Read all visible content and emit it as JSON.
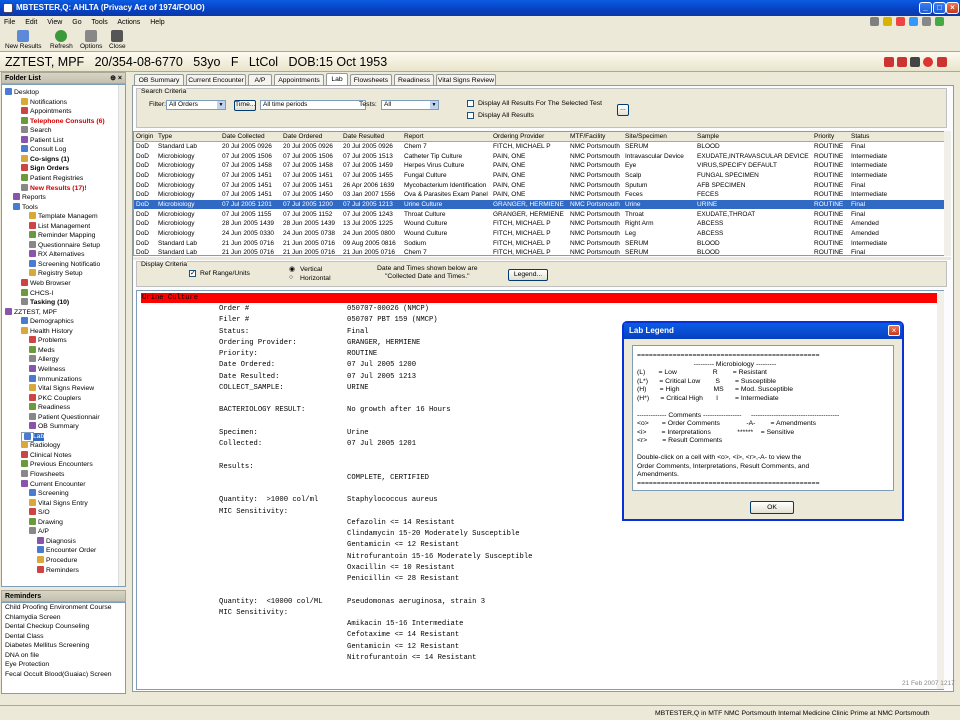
{
  "app_title": "MBTESTER,Q: AHLTA (Privacy Act of 1974/FOUO)",
  "menu": [
    "File",
    "Edit",
    "View",
    "Go",
    "Tools",
    "Actions",
    "Help"
  ],
  "toolbar": {
    "new_results": "New Results",
    "refresh": "Refresh",
    "options": "Options",
    "close": "Close"
  },
  "patient": {
    "name": "ZZTEST, MPF",
    "id": "20/354-08-6770",
    "age": "53yo",
    "sex": "F",
    "rank": "LtCol",
    "dob": "DOB:15 Oct 1953"
  },
  "folder_list": {
    "title": "Folder List",
    "items": [
      {
        "label": "Desktop",
        "indent": 0,
        "style": ""
      },
      {
        "label": "Notifications",
        "indent": 2,
        "style": ""
      },
      {
        "label": "Appointments",
        "indent": 2,
        "style": ""
      },
      {
        "label": "Telephone Consults (6)",
        "indent": 2,
        "style": "red"
      },
      {
        "label": "Search",
        "indent": 2,
        "style": ""
      },
      {
        "label": "Patient List",
        "indent": 2,
        "style": ""
      },
      {
        "label": "Consult Log",
        "indent": 2,
        "style": ""
      },
      {
        "label": "Co-signs (1)",
        "indent": 2,
        "style": "bold"
      },
      {
        "label": "Sign Orders",
        "indent": 2,
        "style": "bold"
      },
      {
        "label": "Patient Registries",
        "indent": 2,
        "style": ""
      },
      {
        "label": "New Results (17)!",
        "indent": 2,
        "style": "red"
      },
      {
        "label": "Reports",
        "indent": 1,
        "style": ""
      },
      {
        "label": "Tools",
        "indent": 1,
        "style": ""
      },
      {
        "label": "Template Managem",
        "indent": 3,
        "style": ""
      },
      {
        "label": "List Management",
        "indent": 3,
        "style": ""
      },
      {
        "label": "Reminder Mapping",
        "indent": 3,
        "style": ""
      },
      {
        "label": "Questionnaire Setup",
        "indent": 3,
        "style": ""
      },
      {
        "label": "RX Alternatives",
        "indent": 3,
        "style": ""
      },
      {
        "label": "Screening Notificatio",
        "indent": 3,
        "style": ""
      },
      {
        "label": "Registry Setup",
        "indent": 3,
        "style": ""
      },
      {
        "label": "Web Browser",
        "indent": 2,
        "style": ""
      },
      {
        "label": "CHCS-I",
        "indent": 2,
        "style": ""
      },
      {
        "label": "Tasking (10)",
        "indent": 2,
        "style": "bold"
      },
      {
        "label": "ZZTEST, MPF",
        "indent": 0,
        "style": ""
      },
      {
        "label": "Demographics",
        "indent": 2,
        "style": ""
      },
      {
        "label": "Health History",
        "indent": 2,
        "style": ""
      },
      {
        "label": "Problems",
        "indent": 3,
        "style": ""
      },
      {
        "label": "Meds",
        "indent": 3,
        "style": ""
      },
      {
        "label": "Allergy",
        "indent": 3,
        "style": ""
      },
      {
        "label": "Wellness",
        "indent": 3,
        "style": ""
      },
      {
        "label": "Immunizations",
        "indent": 3,
        "style": ""
      },
      {
        "label": "Vital Signs Review",
        "indent": 3,
        "style": ""
      },
      {
        "label": "PKC Couplers",
        "indent": 3,
        "style": ""
      },
      {
        "label": "Readiness",
        "indent": 3,
        "style": ""
      },
      {
        "label": "Patient Questionnair",
        "indent": 3,
        "style": ""
      },
      {
        "label": "OB Summary",
        "indent": 3,
        "style": ""
      },
      {
        "label": "Lab",
        "indent": 2,
        "style": "sel"
      },
      {
        "label": "Radiology",
        "indent": 2,
        "style": ""
      },
      {
        "label": "Clinical Notes",
        "indent": 2,
        "style": ""
      },
      {
        "label": "Previous Encounters",
        "indent": 2,
        "style": ""
      },
      {
        "label": "Flowsheets",
        "indent": 2,
        "style": ""
      },
      {
        "label": "Current Encounter",
        "indent": 2,
        "style": ""
      },
      {
        "label": "Screening",
        "indent": 3,
        "style": ""
      },
      {
        "label": "Vital Signs Entry",
        "indent": 3,
        "style": ""
      },
      {
        "label": "S/O",
        "indent": 3,
        "style": ""
      },
      {
        "label": "Drawing",
        "indent": 3,
        "style": ""
      },
      {
        "label": "A/P",
        "indent": 3,
        "style": ""
      },
      {
        "label": "Diagnosis",
        "indent": 4,
        "style": ""
      },
      {
        "label": "Encounter Order",
        "indent": 4,
        "style": ""
      },
      {
        "label": "Procedure",
        "indent": 4,
        "style": ""
      },
      {
        "label": "Reminders",
        "indent": 4,
        "style": ""
      }
    ]
  },
  "reminders": {
    "title": "Reminders",
    "items": [
      "Child Proofing Environment Course",
      "Chlamydia Screen",
      "Dental Checkup Counseling",
      "Dental Class",
      "Diabetes Mellitus Screening",
      "DNA on file",
      "Eye Protection",
      "Fecal Occult Blood(Guaiac) Screen"
    ]
  },
  "tabs": [
    "OB Summary",
    "Current Encounter",
    "A/P",
    "Appointments",
    "Lab",
    "Flowsheets",
    "Readiness",
    "Vital Signs Review"
  ],
  "active_tab": "Lab",
  "search": {
    "legend": "Search Criteria",
    "filter_label": "Filter:",
    "filter_value": "All Orders",
    "time_button": "Time...",
    "time_value": "All time periods",
    "tests_label": "Tests:",
    "tests_value": "All",
    "display_selected": "Display All Results For The Selected Test",
    "display_all": "Display All Results",
    "more_button": "..."
  },
  "grid": {
    "columns": [
      "Origin",
      "Type",
      "Date Collected",
      "Date Ordered",
      "Date Resulted",
      "Report",
      "Ordering Provider",
      "MTF/Facility",
      "Site/Specimen",
      "Sample",
      "Priority",
      "Status"
    ],
    "rows": [
      [
        "DoD",
        "Standard Lab",
        "20 Jul 2005 0926",
        "20 Jul 2005 0926",
        "20 Jul 2005 0926",
        "Chem 7",
        "FITCH, MICHAEL P",
        "NMC Portsmouth",
        "SERUM",
        "BLOOD",
        "ROUTINE",
        "Final"
      ],
      [
        "DoD",
        "Microbiology",
        "07 Jul 2005 1506",
        "07 Jul 2005 1506",
        "07 Jul 2005 1513",
        "Catheter Tip Culture",
        "PAIN, ONE",
        "NMC Portsmouth",
        "Intravascular Device",
        "EXUDATE,INTRAVASCULAR DEVICE",
        "ROUTINE",
        "Intermediate"
      ],
      [
        "DoD",
        "Microbiology",
        "07 Jul 2005 1458",
        "07 Jul 2005 1458",
        "07 Jul 2005 1459",
        "Herpes Virus Culture",
        "PAIN, ONE",
        "NMC Portsmouth",
        "Eye",
        "VIRUS,SPECIFY DEFAULT",
        "ROUTINE",
        "Intermediate"
      ],
      [
        "DoD",
        "Microbiology",
        "07 Jul 2005 1451",
        "07 Jul 2005 1451",
        "07 Jul 2005 1455",
        "Fungal Culture",
        "PAIN, ONE",
        "NMC Portsmouth",
        "Scalp",
        "FUNGAL SPECIMEN",
        "ROUTINE",
        "Intermediate"
      ],
      [
        "DoD",
        "Microbiology",
        "07 Jul 2005 1451",
        "07 Jul 2005 1451",
        "26 Apr 2006 1639",
        "Mycobacterium Identification",
        "PAIN, ONE",
        "NMC Portsmouth",
        "Sputum",
        "AFB SPECIMEN",
        "ROUTINE",
        "Final"
      ],
      [
        "DoD",
        "Microbiology",
        "07 Jul 2005 1451",
        "07 Jul 2005 1450",
        "03 Jan 2007 1556",
        "Ova & Parasites Exam Panel",
        "PAIN, ONE",
        "NMC Portsmouth",
        "Feces",
        "FECES",
        "ROUTINE",
        "Intermediate"
      ],
      [
        "DoD",
        "Microbiology",
        "07 Jul 2005 1201",
        "07 Jul 2005 1200",
        "07 Jul 2005 1213",
        "Urine Culture",
        "GRANGER, HERMIENE",
        "NMC Portsmouth",
        "Urine",
        "URINE",
        "ROUTINE",
        "Final"
      ],
      [
        "DoD",
        "Microbiology",
        "07 Jul 2005 1155",
        "07 Jul 2005 1152",
        "07 Jul 2005 1243",
        "Throat Culture",
        "GRANGER, HERMIENE",
        "NMC Portsmouth",
        "Throat",
        "EXUDATE,THROAT",
        "ROUTINE",
        "Final"
      ],
      [
        "DoD",
        "Microbiology",
        "28 Jun 2005 1439",
        "28 Jun 2005 1439",
        "13 Jul 2005 1225",
        "Wound Culture",
        "FITCH, MICHAEL P",
        "NMC Portsmouth",
        "Right Arm",
        "ABCESS",
        "ROUTINE",
        "Amended"
      ],
      [
        "DoD",
        "Microbiology",
        "24 Jun 2005 0330",
        "24 Jun 2005 0738",
        "24 Jun 2005 0800",
        "Wound Culture",
        "FITCH, MICHAEL P",
        "NMC Portsmouth",
        "Leg",
        "ABCESS",
        "ROUTINE",
        "Amended"
      ],
      [
        "DoD",
        "Standard Lab",
        "21 Jun 2005 0716",
        "21 Jun 2005 0716",
        "09 Aug 2005 0816",
        "Sodium",
        "FITCH, MICHAEL P",
        "NMC Portsmouth",
        "SERUM",
        "BLOOD",
        "ROUTINE",
        "Intermediate"
      ],
      [
        "DoD",
        "Standard Lab",
        "21 Jun 2005 0716",
        "21 Jun 2005 0716",
        "21 Jun 2005 0716",
        "Chem 7",
        "FITCH, MICHAEL P",
        "NMC Portsmouth",
        "SERUM",
        "BLOOD",
        "ROUTINE",
        "Final"
      ]
    ],
    "highlight_row": 6
  },
  "display": {
    "legend": "Display Criteria",
    "ref_range": "Ref Range/Units",
    "vertical": "Vertical",
    "horizontal": "Horizontal",
    "note": "Date and Times shown below are\n\"Collected Date and Times.\"",
    "legend_button": "Legend..."
  },
  "detail": {
    "header": "Urine Culture",
    "lines": [
      [
        "Order #",
        "050707-00026 (NMCP)"
      ],
      [
        "Filer #",
        "050707 PBT 159 (NMCP)"
      ],
      [
        "Status:",
        "Final"
      ],
      [
        "Ordering Provider:",
        "GRANGER, HERMIENE"
      ],
      [
        "Priority:",
        "ROUTINE"
      ],
      [
        "Date Ordered:",
        "07 Jul 2005 1200"
      ],
      [
        "Date Resulted:",
        "07 Jul 2005 1213"
      ],
      [
        "COLLECT_SAMPLE:",
        "URINE"
      ],
      [
        "",
        ""
      ],
      [
        "BACTERIOLOGY RESULT:",
        "No growth after 16 Hours"
      ],
      [
        "",
        ""
      ],
      [
        "Specimen:",
        "Urine"
      ],
      [
        "Collected:",
        "07 Jul 2005 1201"
      ],
      [
        "",
        ""
      ],
      [
        "Results:",
        ""
      ],
      [
        "",
        "COMPLETE, CERTIFIED"
      ],
      [
        "",
        ""
      ],
      [
        "Quantity:  >1000 col/ml",
        "Staphylococcus aureus"
      ],
      [
        "MIC Sensitivity:",
        ""
      ],
      [
        "",
        "Cefazolin <= 14 Resistant"
      ],
      [
        "",
        "Clindamycin 15-20 Moderately Susceptible"
      ],
      [
        "",
        "Gentamicin <= 12 Resistant"
      ],
      [
        "",
        "Nitrofurantoin 15-16 Moderately Susceptible"
      ],
      [
        "",
        "Oxacillin <= 10 Resistant"
      ],
      [
        "",
        "Penicillin <= 28 Resistant"
      ],
      [
        "",
        ""
      ],
      [
        "Quantity:  <10000 col/ML",
        "Pseudomonas aeruginosa, strain 3"
      ],
      [
        "MIC Sensitivity:",
        ""
      ],
      [
        "",
        "Amikacin 15-16 Intermediate"
      ],
      [
        "",
        "Cefotaxime <= 14 Resistant"
      ],
      [
        "",
        "Gentamicin <= 12 Resistant"
      ],
      [
        "",
        "Nitrofurantoin <= 14 Resistant"
      ]
    ]
  },
  "dialog": {
    "title": "Lab Legend",
    "lines": [
      "==============================================",
      "                              --------- Microbiology ---------",
      "(L)       = Low                   R        = Resistant",
      "(L*)      = Critical Low        S        = Susceptible",
      "(H)       = High                  MS      = Mod. Susceptible",
      "(H*)      = Critical High       I         = Intermediate",
      "",
      "------------- Comments -----------------     ---------------------------------------",
      "<o>       = Order Comments              -A-        = Amendments",
      "<i>        = Interpretations              ******    = Sensitive",
      "<r>        = Result Comments",
      "",
      "Double-click on a cell with <o>, <i>, <r>,-A- to view the",
      "Order Comments, Interpretations, Result Comments, and",
      "Amendments.",
      "=============================================="
    ],
    "ok": "OK"
  },
  "timestamp": "21 Feb 2007 1217",
  "status": {
    "user": "MBTESTER,Q  in  MTF NMC Portsmouth  Internal Medicine Clinic Prime at NMC Portsmouth"
  }
}
